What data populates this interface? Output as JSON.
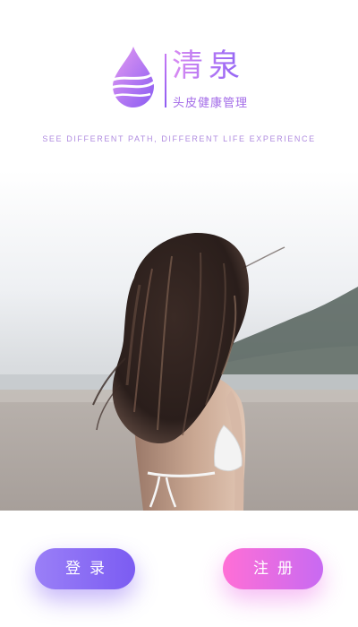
{
  "brand": {
    "name": "清泉",
    "subtitle": "头皮健康管理",
    "logo_icon": "water-drop-icon"
  },
  "tagline": "SEE DIFFERENT PATH, DIFFERENT LIFE EXPERIENCE",
  "hero": {
    "image": "woman-with-windblown-hair-on-beach-photo"
  },
  "actions": {
    "login_label": "登录",
    "register_label": "注册"
  },
  "colors": {
    "brand_purple": "#9a6cf0",
    "brand_pink": "#d98bf2",
    "login_gradient": [
      "#9a7ff7",
      "#7b5cf2"
    ],
    "register_gradient": [
      "#ff6fd6",
      "#c86af2"
    ]
  }
}
